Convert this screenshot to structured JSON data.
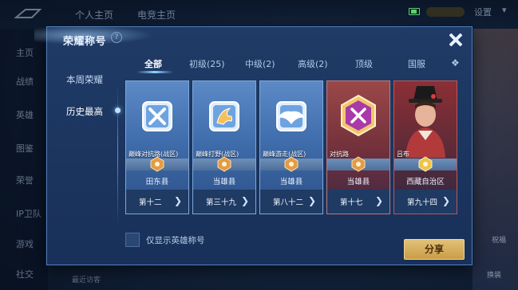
{
  "background": {
    "top_tabs": [
      "个人主页",
      "电竞主页"
    ],
    "settings_label": "设置",
    "sidebar_items": [
      "主页",
      "战绩",
      "英雄",
      "图鉴",
      "荣誉",
      "IP卫队",
      "游戏",
      "社交"
    ],
    "right_labels": [
      "祝福",
      "换装"
    ],
    "friend_text": "最近访客"
  },
  "dialog": {
    "title": "荣耀称号",
    "help_icon": "help-icon",
    "close_icon": "close-icon",
    "side_nav": [
      {
        "label": "本周荣耀",
        "active": false
      },
      {
        "label": "历史最高",
        "active": true
      }
    ],
    "tabs": [
      {
        "label": "全部",
        "active": true
      },
      {
        "label": "初级(25)",
        "active": false
      },
      {
        "label": "中级(2)",
        "active": false
      },
      {
        "label": "高级(2)",
        "active": false
      },
      {
        "label": "顶级",
        "active": false
      },
      {
        "label": "国服",
        "active": false
      }
    ],
    "tab_more_icon": "grid-more-icon",
    "cards": [
      {
        "name": "巅峰对抗路(战区)",
        "region": "田东县",
        "rank": "第十二",
        "icon": "crossed-swords-badge"
      },
      {
        "name": "巅峰打野(战区)",
        "region": "当雄县",
        "rank": "第三十九",
        "icon": "dragon-badge"
      },
      {
        "name": "巅峰游走(战区)",
        "region": "当雄县",
        "rank": "第八十二",
        "icon": "winged-shield-badge"
      },
      {
        "name": "对抗路",
        "region": "当雄县",
        "rank": "第十七",
        "icon": "golden-hexagon-badge"
      },
      {
        "name": "吕布",
        "region": "西藏自治区",
        "rank": "第九十四",
        "icon": "hero-portrait"
      }
    ],
    "only_hero_label": "仅显示英雄称号",
    "only_hero_checked": false,
    "share_label": "分享"
  },
  "colors": {
    "dialog_bg": "#1f3b66",
    "card_blue": "#4d7bb8",
    "card_red": "#8a3a3a",
    "share_gold": "#d8b466",
    "accent": "#8fd4ff"
  }
}
